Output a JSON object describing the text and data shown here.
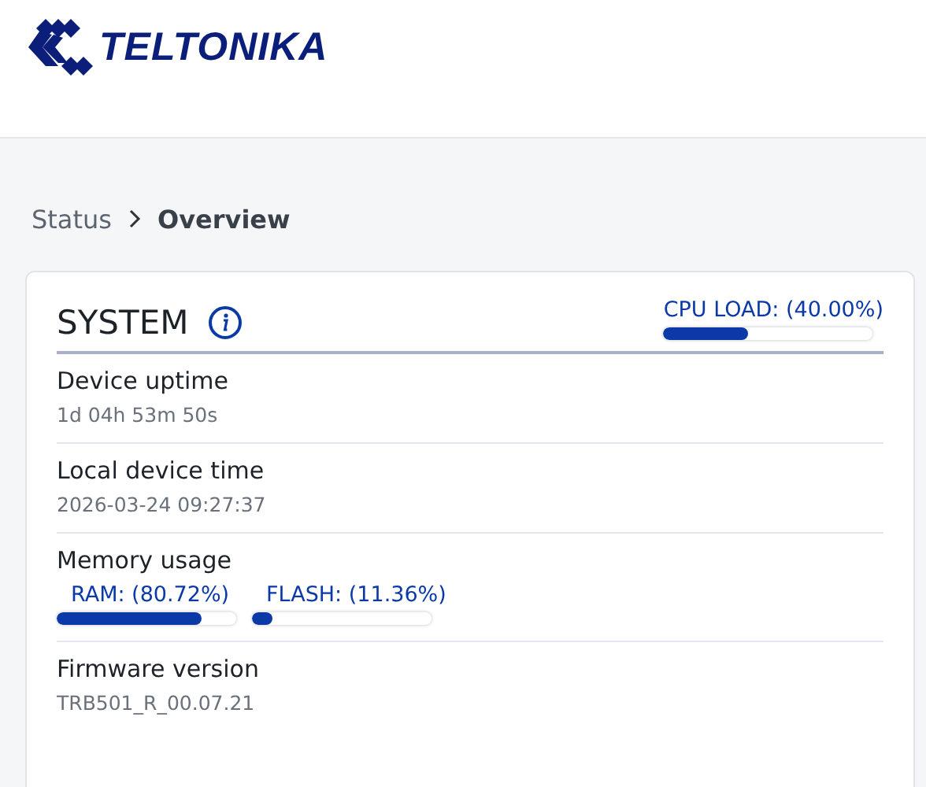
{
  "header": {
    "logo_text": "TELTONIKA"
  },
  "breadcrumb": [
    {
      "label": "Status",
      "current": false
    },
    {
      "label": "Overview",
      "current": true
    }
  ],
  "card": {
    "title": "SYSTEM",
    "cpu": {
      "label": "CPU LOAD: (40.00%)",
      "level": 0.4
    },
    "rows": [
      {
        "kind": "text",
        "label": "Device uptime",
        "value": "1d 04h 53m 50s"
      },
      {
        "kind": "text",
        "label": "Local device time",
        "value": "2026-03-24 09:27:37"
      },
      {
        "kind": "meters",
        "label": "Memory usage",
        "meters": [
          {
            "label": "RAM: (80.72%)",
            "level": 0.8072
          },
          {
            "label": "FLASH: (11.36%)",
            "level": 0.1136
          }
        ]
      },
      {
        "kind": "text",
        "label": "Firmware version",
        "value": "TRB501_R_00.07.21"
      }
    ]
  }
}
